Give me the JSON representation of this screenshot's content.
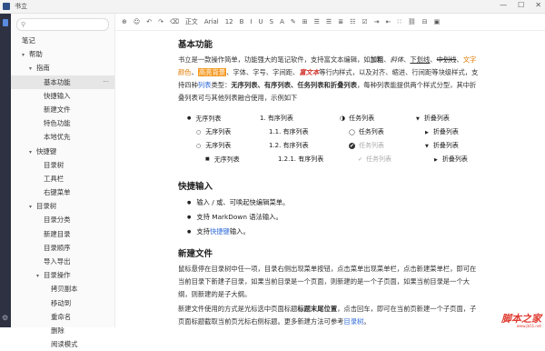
{
  "window": {
    "title": "书立",
    "controls": [
      "—",
      "☐",
      "✕"
    ]
  },
  "sidebar": {
    "search_placeholder": "",
    "tree": [
      {
        "label": "笔记",
        "indent": 0,
        "caret": ""
      },
      {
        "label": "帮助",
        "indent": 1,
        "caret": "▾"
      },
      {
        "label": "指南",
        "indent": 2,
        "caret": "▾"
      },
      {
        "label": "基本功能",
        "indent": 3,
        "caret": "",
        "selected": true,
        "more": "···"
      },
      {
        "label": "快捷输入",
        "indent": 3,
        "caret": ""
      },
      {
        "label": "新建文件",
        "indent": 3,
        "caret": ""
      },
      {
        "label": "特色功能",
        "indent": 3,
        "caret": ""
      },
      {
        "label": "本地优先",
        "indent": 3,
        "caret": ""
      },
      {
        "label": "快捷键",
        "indent": 2,
        "caret": "▾"
      },
      {
        "label": "目录树",
        "indent": 3,
        "caret": ""
      },
      {
        "label": "工具栏",
        "indent": 3,
        "caret": ""
      },
      {
        "label": "右键菜单",
        "indent": 3,
        "caret": ""
      },
      {
        "label": "目录树",
        "indent": 2,
        "caret": "▾"
      },
      {
        "label": "目录分类",
        "indent": 3,
        "caret": ""
      },
      {
        "label": "新建目录",
        "indent": 3,
        "caret": ""
      },
      {
        "label": "目录顺序",
        "indent": 3,
        "caret": ""
      },
      {
        "label": "导入导出",
        "indent": 3,
        "caret": ""
      },
      {
        "label": "目录操作",
        "indent": 3,
        "caret": "▾"
      },
      {
        "label": "拷贝副本",
        "indent": 4,
        "caret": ""
      },
      {
        "label": "移动到",
        "indent": 4,
        "caret": ""
      },
      {
        "label": "重命名",
        "indent": 4,
        "caret": ""
      },
      {
        "label": "删除",
        "indent": 4,
        "caret": ""
      },
      {
        "label": "阅读模式",
        "indent": 4,
        "caret": ""
      }
    ]
  },
  "toolbar": {
    "items": [
      "⊕",
      "☺",
      "↶",
      "↷",
      "⌫",
      "正文",
      "Arial",
      "12",
      "B",
      "I",
      "U",
      "S",
      "A",
      "✎",
      "⊞",
      "☰",
      "☰",
      "≣",
      "☷",
      "☑",
      "⇥",
      "⇤",
      "∷",
      "⛓",
      "⊟",
      "▣"
    ]
  },
  "doc": {
    "h_basic": "基本功能",
    "p1_a": "书立是一款操作简单，功能强大的笔记软件，支持富文本编辑，如",
    "p1_bold": "加粗",
    "p1_b": "、",
    "p1_italic": "斜体",
    "p1_c": "、",
    "p1_underline": "下划线",
    "p1_d": "、",
    "p1_strike": "中划线",
    "p1_e": "、",
    "p1_color": "文字颜色",
    "p1_f": "、",
    "p1_bg": "高亮背景",
    "p1_g": "、字体、字号、字间距、",
    "p1_red": "富文本",
    "p1_h": "等行内样式，以及对齐、缩进、行间距等块级样式，支持四种",
    "p1_link": "列表",
    "p1_i": "类型：",
    "p1_types": "无序列表、有序列表、任务列表和折叠列表",
    "p1_j": "，每种列表能提供两个样式分型，其中折叠列表可与其他列表融合使用，示例如下",
    "lists": {
      "unordered": [
        "无序列表",
        "无序列表",
        "无序列表",
        "无序列表"
      ],
      "ordered": [
        "1. 有序列表",
        "1.1. 有序列表",
        "1.2. 有序列表",
        "1.2.1. 有序列表"
      ],
      "task": [
        "任务列表",
        "任务列表",
        "任务列表",
        "任务列表"
      ],
      "fold": [
        "折叠列表",
        "折叠列表",
        "折叠列表",
        "折叠列表"
      ]
    },
    "h_quick": "快捷输入",
    "quick_items": [
      "输入 / 或、可唤起快编辑菜单。",
      "支持 MarkDown 语法输入。"
    ],
    "quick_3a": "支持",
    "quick_3link": "快捷键",
    "quick_3b": "输入。",
    "h_newfile": "新建文件",
    "nf_p1": "鼠标悬停在目录树中任一项，目录右侧出现菜单按钮，点击菜单出现菜单栏，点击新建菜单栏，即可在当前目录下新建子目录，如果当前目录是一个页面，则新建的是一个子页面，如果当前目录是一个大纲，则新建的是子大纲。",
    "nf_p2a": "新建文件使用的方式是光标选中页面标题",
    "nf_p2bold": "标题末尾位置",
    "nf_p2b": "，点击回车，即可在当前页新建一个子页面，子页面标题截取当前页光标右侧标题。更多新建方法可参考",
    "nf_p2link": "目录树",
    "nf_p2c": "。"
  },
  "watermark": {
    "text": "脚本之家",
    "sub": "www.jb51.net"
  },
  "colors": {
    "accent": "#2f6bd8",
    "orange": "#e07b00",
    "highlight_bg": "#f59a23",
    "red": "#d0342c"
  }
}
